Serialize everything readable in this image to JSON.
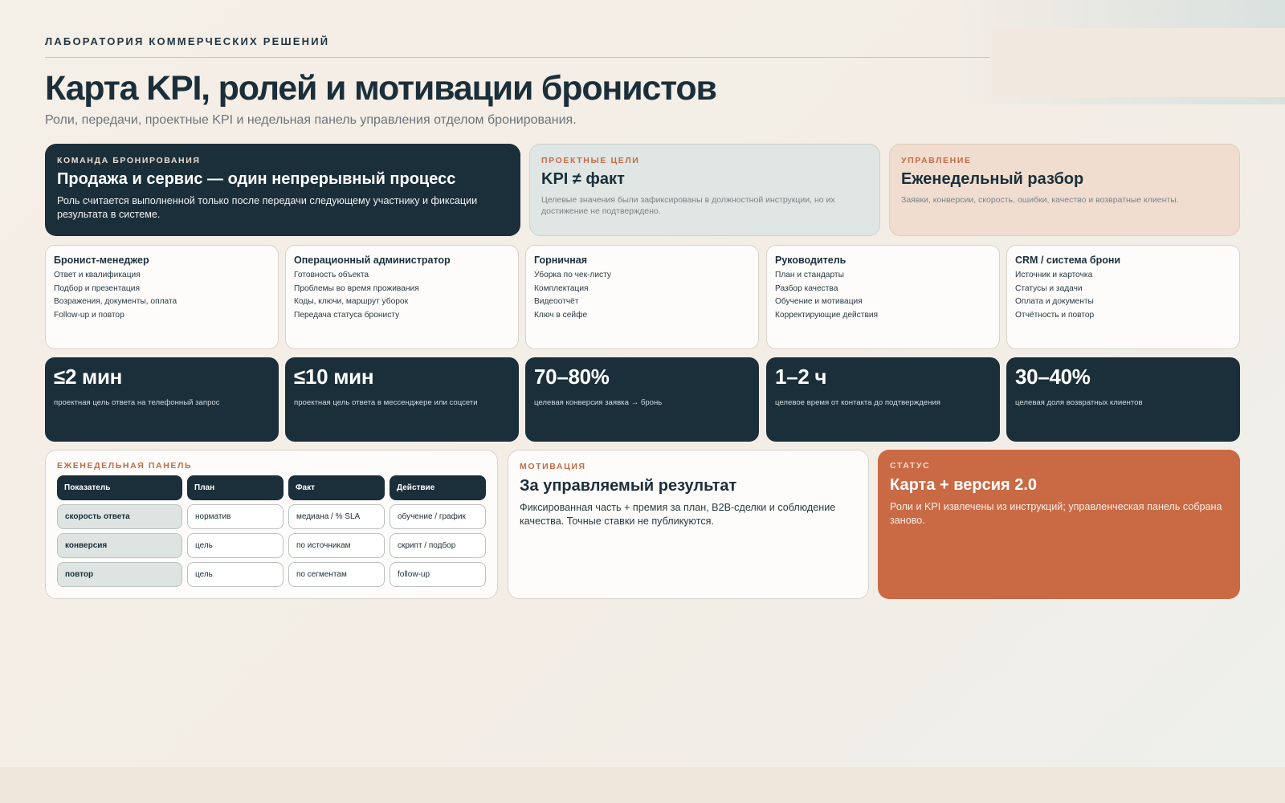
{
  "header": {
    "kicker": "ЛАБОРАТОРИЯ КОММЕРЧЕСКИХ РЕШЕНИЙ",
    "title": "Карта KPI, ролей и мотивации бронистов",
    "subtitle": "Роли, передачи, проектные KPI и недельная панель управления отделом бронирования."
  },
  "top_cards": {
    "team": {
      "label": "КОМАНДА БРОНИРОВАНИЯ",
      "title": "Продажа и сервис — один непрерывный процесс",
      "text": "Роль считается выполненной только после передачи следующему участнику и фиксации результата в системе."
    },
    "goals": {
      "label": "ПРОЕКТНЫЕ ЦЕЛИ",
      "title": "KPI ≠ факт",
      "text": "Целевые значения были зафиксированы в должностной инструкции, но их достижение не подтверждено."
    },
    "manage": {
      "label": "УПРАВЛЕНИЕ",
      "title": "Еженедельный разбор",
      "text": "Заявки, конверсии, скорость, ошибки, качество и возвратные клиенты."
    }
  },
  "roles": [
    {
      "title": "Бронист-менеджер",
      "items": [
        "Ответ и квалификация",
        "Подбор и презентация",
        "Возражения, документы, оплата",
        "Follow-up и повтор"
      ]
    },
    {
      "title": "Операционный администратор",
      "items": [
        "Готовность объекта",
        "Проблемы во время проживания",
        "Коды, ключи, маршрут уборок",
        "Передача статуса бронисту"
      ]
    },
    {
      "title": "Горничная",
      "items": [
        "Уборка по чек-листу",
        "Комплектация",
        "Видеоотчёт",
        "Ключ в сейфе"
      ]
    },
    {
      "title": "Руководитель",
      "items": [
        "План и стандарты",
        "Разбор качества",
        "Обучение и мотивация",
        "Корректирующие действия"
      ]
    },
    {
      "title": "CRM / система брони",
      "items": [
        "Источник и карточка",
        "Статусы и задачи",
        "Оплата и документы",
        "Отчётность и повтор"
      ]
    }
  ],
  "kpis": [
    {
      "value": "≤2 мин",
      "desc": "проектная цель ответа на телефонный запрос"
    },
    {
      "value": "≤10 мин",
      "desc": "проектная цель ответа в мессенджере или соцсети"
    },
    {
      "value": "70–80%",
      "desc": "целевая конверсия заявка → бронь"
    },
    {
      "value": "1–2 ч",
      "desc": "целевое время от контакта до подтверждения"
    },
    {
      "value": "30–40%",
      "desc": "целевая доля возвратных клиентов"
    }
  ],
  "panel": {
    "label": "ЕЖЕНЕДЕЛЬНАЯ ПАНЕЛЬ",
    "columns": [
      "Показатель",
      "План",
      "Факт",
      "Действие"
    ],
    "rows": [
      [
        "скорость ответа",
        "норматив",
        "медиана / % SLA",
        "обучение / график"
      ],
      [
        "конверсия",
        "цель",
        "по источникам",
        "скрипт / подбор"
      ],
      [
        "повтор",
        "цель",
        "по сегментам",
        "follow-up"
      ]
    ]
  },
  "motivation": {
    "label": "МОТИВАЦИЯ",
    "title": "За управляемый результат",
    "text": "Фиксированная часть + премия за план, B2B-сделки и соблюдение качества. Точные ставки не публикуются."
  },
  "status": {
    "label": "СТАТУС",
    "title": "Карта + версия 2.0",
    "text": "Роли и KPI извлечены из инструкций; управленческая панель собрана заново."
  },
  "colors": {
    "navy": "#1b2f3a",
    "accent": "#c96a45",
    "sage": "#dfe6e3",
    "peach": "#f0ddd0"
  }
}
